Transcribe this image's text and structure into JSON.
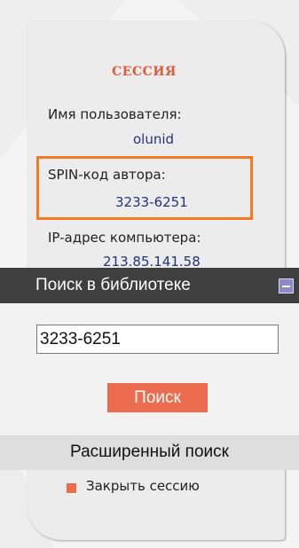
{
  "session": {
    "title": "СЕССИЯ",
    "username_label": "Имя пользователя:",
    "username_value": "olunid",
    "spin_label": "SPIN-код автора:",
    "spin_value": "3233-6251",
    "ip_label": "IP-адрес компьютера:",
    "ip_value": "213.85.141.58",
    "close_label": "Закрыть сессию"
  },
  "search": {
    "title": "Поиск в библиотеке",
    "input_value": "3233-6251",
    "button_label": "Поиск",
    "advanced_label": "Расширенный поиск"
  },
  "colors": {
    "accent": "#ec6c4f",
    "highlight_border": "#f47a1f",
    "header_bg": "#3f3f3f",
    "value_text": "#22357c"
  }
}
